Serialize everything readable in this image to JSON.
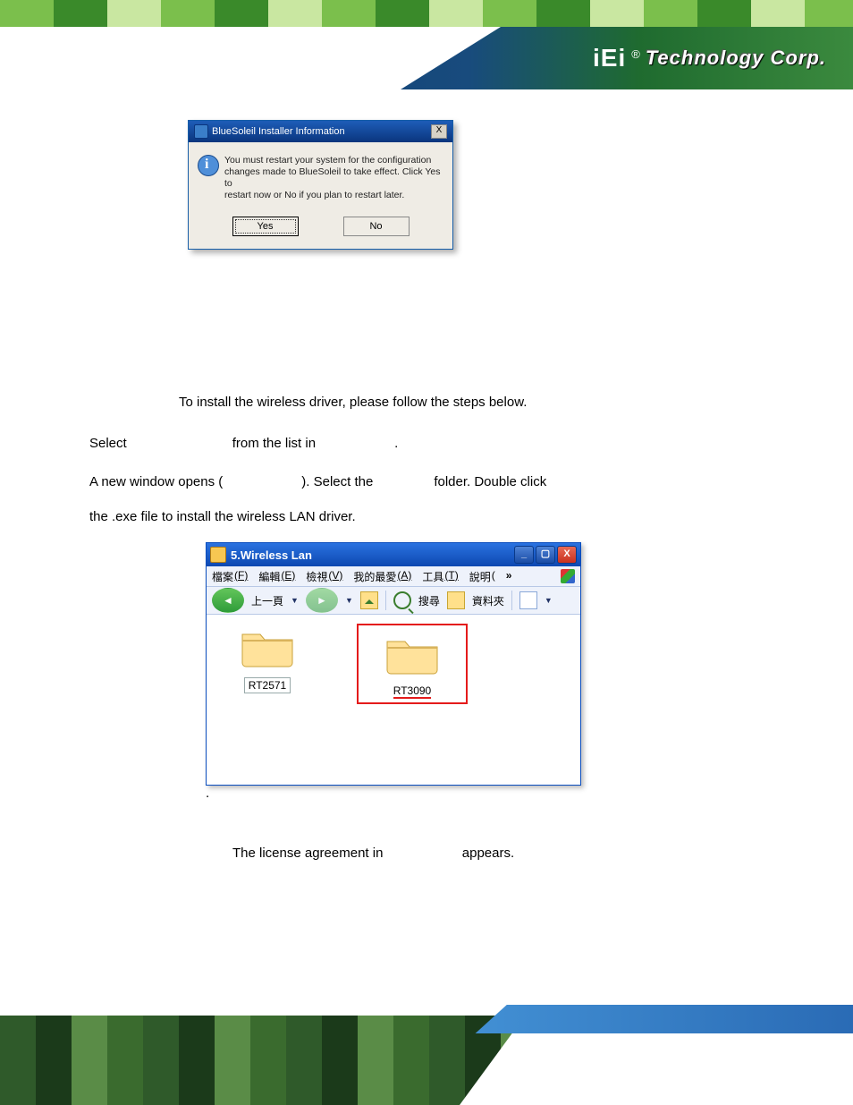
{
  "brand": {
    "logo": "iEi",
    "reg": "®",
    "name": "Technology Corp."
  },
  "dialog": {
    "title": "BlueSoleil Installer Information",
    "msg1": "You must restart your system for the configuration",
    "msg2": "changes made to BlueSoleil to take effect. Click Yes to",
    "msg3": "restart now or No if you plan to restart later.",
    "yes": "Yes",
    "no": "No",
    "close": "X"
  },
  "text": {
    "intro": "To install the wireless driver, please follow the steps below.",
    "step1_select": "Select",
    "step1_from": "from the list in",
    "step1_dot": ".",
    "step2_a": "A new window opens (",
    "step2_b": "). Select the",
    "step2_c": "folder. Double click",
    "step2_d": "the .exe file to install the wireless LAN driver.",
    "dot": ".",
    "step3_a": "The license agreement in",
    "step3_b": "appears."
  },
  "explorer": {
    "title": "5.Wireless Lan",
    "menu": {
      "file": "檔案",
      "file_acc": "(F)",
      "edit": "編輯",
      "edit_acc": "(E)",
      "view": "檢視",
      "view_acc": "(V)",
      "fav": "我的最愛",
      "fav_acc": "(A)",
      "tools": "工具",
      "tools_acc": "(T)",
      "help": "說明",
      "help_acc": "(",
      "overflow": "»"
    },
    "toolbar": {
      "back": "上一頁",
      "search": "搜尋",
      "folders": "資料夾"
    },
    "items": [
      {
        "label": "RT2571"
      },
      {
        "label": "RT3090"
      }
    ],
    "win": {
      "min": "_",
      "max": "▢",
      "close": "X"
    }
  }
}
